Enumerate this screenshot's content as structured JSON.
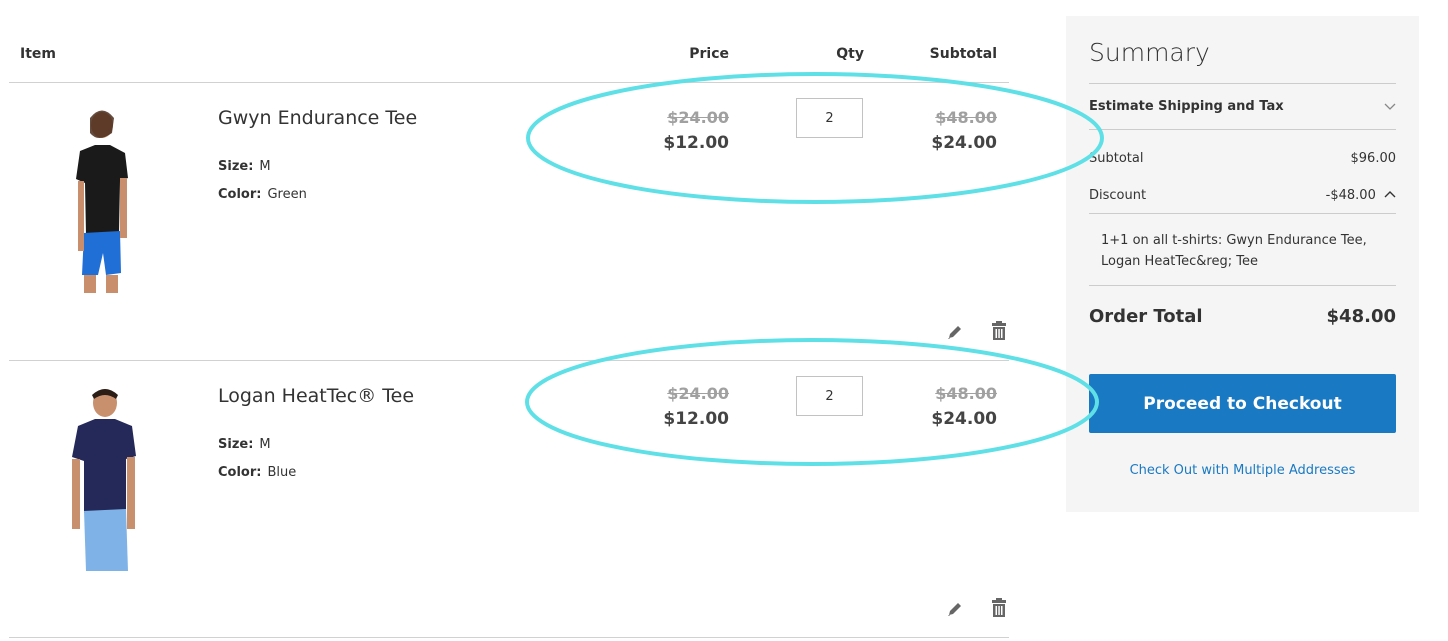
{
  "table": {
    "headers": {
      "item": "Item",
      "price": "Price",
      "qty": "Qty",
      "subtotal": "Subtotal"
    },
    "rows": [
      {
        "name": "Gwyn Endurance Tee",
        "options": [
          {
            "label": "Size:",
            "value": "M"
          },
          {
            "label": "Color:",
            "value": "Green"
          }
        ],
        "original_price": "$24.00",
        "price": "$12.00",
        "qty": "2",
        "original_subtotal": "$48.00",
        "subtotal": "$24.00",
        "image": "woman-black-tee-blue-shorts",
        "shirt_color": "#1a1a1a",
        "pants_color": "#1f6fd6"
      },
      {
        "name": "Logan HeatTec® Tee",
        "options": [
          {
            "label": "Size:",
            "value": "M"
          },
          {
            "label": "Color:",
            "value": "Blue"
          }
        ],
        "original_price": "$24.00",
        "price": "$12.00",
        "qty": "2",
        "original_subtotal": "$48.00",
        "subtotal": "$24.00",
        "image": "man-navy-tee-light-blue-shorts",
        "shirt_color": "#25295a",
        "pants_color": "#7fb3e8"
      }
    ],
    "actions": {
      "edit_icon": "pencil-icon",
      "delete_icon": "trash-icon"
    }
  },
  "summary": {
    "title": "Summary",
    "estimate_label": "Estimate Shipping and Tax",
    "subtotal_label": "Subtotal",
    "subtotal_value": "$96.00",
    "discount_label": "Discount",
    "discount_value": "-$48.00",
    "discount_note": "1+1 on all t-shirts: Gwyn Endurance Tee, Logan HeatTec&reg; Tee",
    "order_total_label": "Order Total",
    "order_total_value": "$48.00",
    "checkout_button": "Proceed to Checkout",
    "multi_address_link": "Check Out with Multiple Addresses"
  },
  "colors": {
    "accent": "#1979c3",
    "annotation": "#5ee0e6",
    "panel_bg": "#f5f5f5"
  }
}
